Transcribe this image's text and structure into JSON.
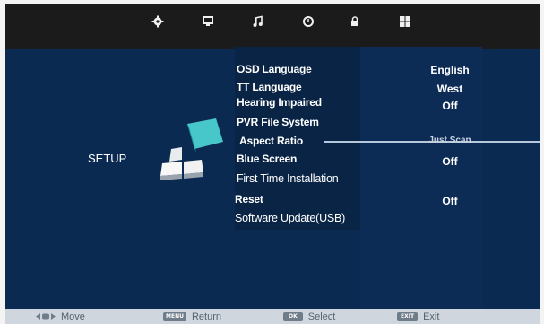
{
  "tabs": [
    {
      "name": "picture-gear-icon"
    },
    {
      "name": "monitor-icon"
    },
    {
      "name": "music-note-icon"
    },
    {
      "name": "clock-icon"
    },
    {
      "name": "lock-icon"
    },
    {
      "name": "setup-grid-icon"
    }
  ],
  "category": {
    "label": "SETUP"
  },
  "menu": {
    "items": [
      {
        "label": "OSD Language",
        "value": "English"
      },
      {
        "label": "TT Language",
        "value": "West"
      },
      {
        "label": "Hearing Impaired",
        "value": "Off"
      },
      {
        "label": "PVR File System",
        "value": ""
      },
      {
        "label": "Aspect Ratio",
        "value": "Just Scan"
      },
      {
        "label": "Blue Screen",
        "value": "Off"
      },
      {
        "label": "First Time Installation",
        "value": ""
      },
      {
        "label": "Reset",
        "value": "Off"
      },
      {
        "label": "Software Update(USB)",
        "value": ""
      }
    ]
  },
  "footer": {
    "move_label": "Move",
    "return_key": "MENU",
    "return_label": "Return",
    "select_key": "OK",
    "select_label": "Select",
    "exit_key": "EXIT",
    "exit_label": "Exit"
  },
  "colors": {
    "background": "#0b2a52",
    "topbar": "#1b1b1b",
    "footer": "#cfd6de"
  }
}
